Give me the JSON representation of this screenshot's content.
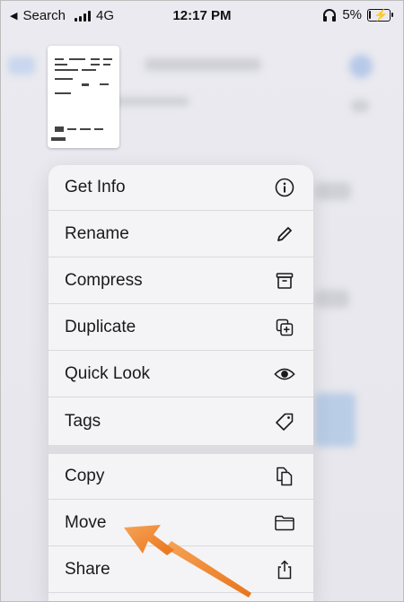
{
  "status_bar": {
    "back_label": "Search",
    "network": "4G",
    "time": "12:17 PM",
    "battery_percent": "5%"
  },
  "menu": {
    "items": [
      {
        "label": "Get Info",
        "icon": "info-icon"
      },
      {
        "label": "Rename",
        "icon": "pencil-icon"
      },
      {
        "label": "Compress",
        "icon": "archive-box-icon"
      },
      {
        "label": "Duplicate",
        "icon": "duplicate-plus-icon"
      },
      {
        "label": "Quick Look",
        "icon": "eye-icon"
      },
      {
        "label": "Tags",
        "icon": "tag-icon"
      },
      {
        "label": "Copy",
        "icon": "copy-documents-icon"
      },
      {
        "label": "Move",
        "icon": "folder-icon"
      },
      {
        "label": "Share",
        "icon": "share-icon"
      }
    ]
  },
  "colors": {
    "arrow": "#f08a2c",
    "menu_background": "#f4f4f6",
    "background": "#e9e9ee"
  }
}
